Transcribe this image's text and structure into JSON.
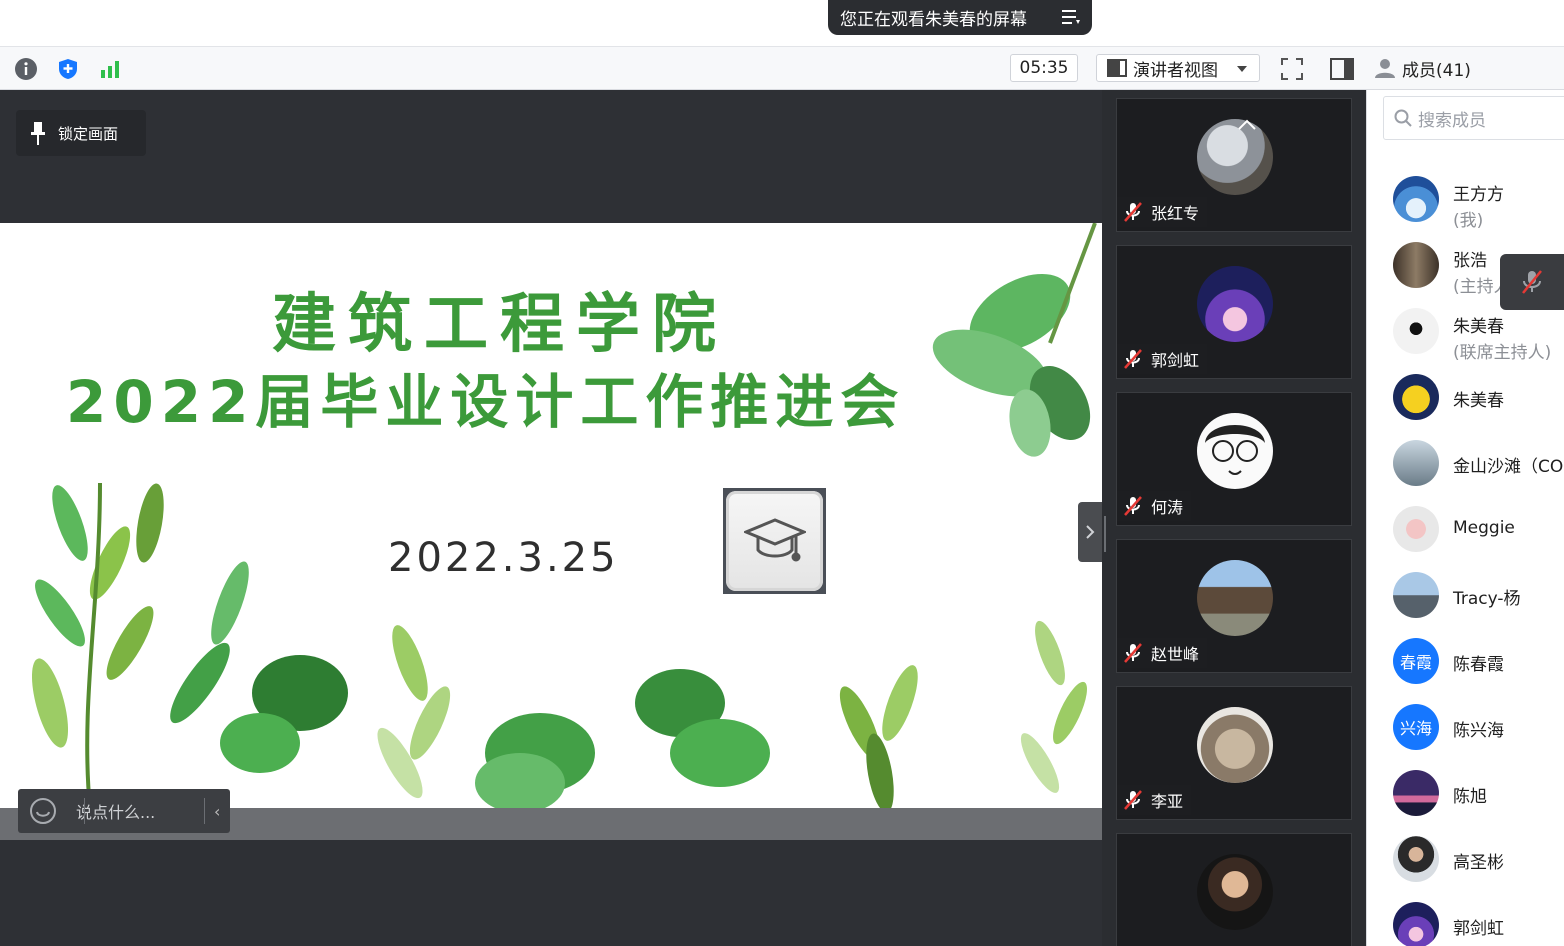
{
  "share_banner": {
    "text": "您正在观看朱美春的屏幕"
  },
  "toolbar": {
    "timer": "05:35",
    "presenter_view_label": "演讲者视图"
  },
  "members_header": {
    "label": "成员(41)"
  },
  "stage": {
    "lock_label": "锁定画面",
    "chat_placeholder": "说点什么..."
  },
  "slide": {
    "title_line1": "建筑工程学院",
    "title_line2": "2022届毕业设计工作推进会",
    "date": "2022.3.25"
  },
  "tiles": [
    {
      "name": "张红专"
    },
    {
      "name": "郭剑虹"
    },
    {
      "name": "何涛"
    },
    {
      "name": "赵世峰"
    },
    {
      "name": "李亚"
    },
    {
      "name": ""
    }
  ],
  "members_search_placeholder": "搜索成员",
  "members": [
    {
      "name": "王方方",
      "role": "(我)"
    },
    {
      "name": "张浩",
      "role": "(主持人"
    },
    {
      "name": "朱美春",
      "role": "(联席主持人)"
    },
    {
      "name": "朱美春",
      "role": ""
    },
    {
      "name": "金山沙滩（CO",
      "role": ""
    },
    {
      "name": "Meggie",
      "role": ""
    },
    {
      "name": "Tracy-杨",
      "role": ""
    },
    {
      "name": "陈春霞",
      "role": "",
      "avatar_text": "春霞"
    },
    {
      "name": "陈兴海",
      "role": "",
      "avatar_text": "兴海"
    },
    {
      "name": "陈旭",
      "role": ""
    },
    {
      "name": "高圣彬",
      "role": ""
    },
    {
      "name": "郭剑虹",
      "role": ""
    }
  ],
  "colors": {
    "accent_blue": "#1677ff",
    "slide_green": "#3c9a3a",
    "stage_bg": "#2e3035"
  }
}
